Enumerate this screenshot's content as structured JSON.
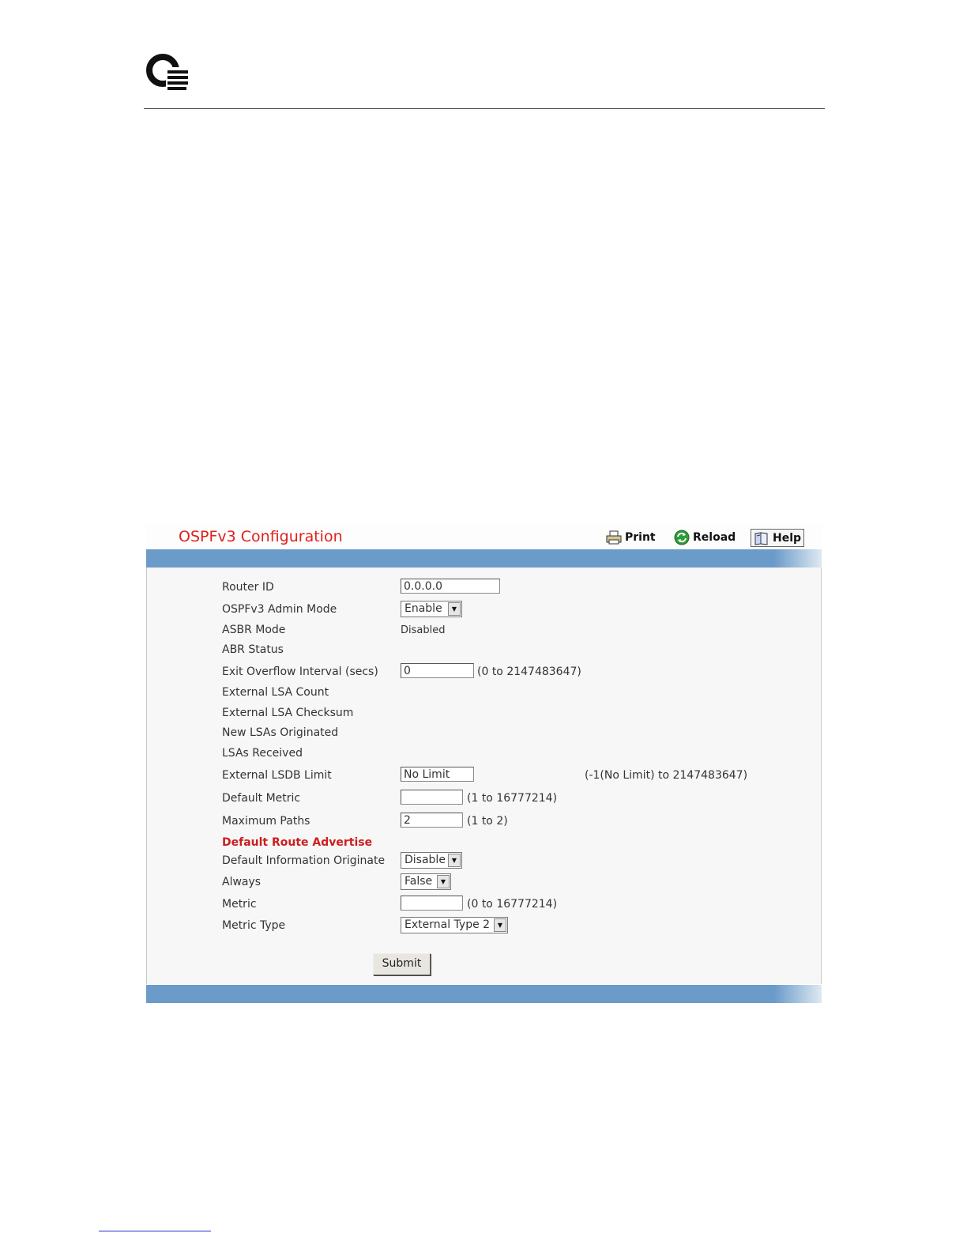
{
  "page": {
    "title": "OSPFv3 Configuration",
    "toolbar": {
      "print": "Print",
      "reload": "Reload",
      "help": "Help"
    }
  },
  "form": {
    "router_id": {
      "label": "Router ID",
      "value": "0.0.0.0"
    },
    "admin_mode": {
      "label": "OSPFv3 Admin Mode",
      "value": "Enable"
    },
    "asbr_mode": {
      "label": "ASBR Mode",
      "value": "Disabled"
    },
    "abr_status": {
      "label": "ABR Status",
      "value": ""
    },
    "exit_overflow": {
      "label": "Exit Overflow Interval (secs)",
      "value": "0",
      "hint": "(0 to 2147483647)"
    },
    "ext_lsa_count": {
      "label": "External LSA Count"
    },
    "ext_lsa_checksum": {
      "label": "External LSA Checksum"
    },
    "new_lsas": {
      "label": "New LSAs Originated"
    },
    "lsas_received": {
      "label": "LSAs Received"
    },
    "ext_lsdb_limit": {
      "label": "External LSDB Limit",
      "value": "No Limit",
      "hint": "(-1(No Limit) to 2147483647)"
    },
    "default_metric": {
      "label": "Default Metric",
      "value": "",
      "hint": "(1 to 16777214)"
    },
    "max_paths": {
      "label": "Maximum Paths",
      "value": "2",
      "hint": "(1 to 2)"
    },
    "section_heading": "Default Route Advertise",
    "default_info_originate": {
      "label": "Default Information Originate",
      "value": "Disable"
    },
    "always": {
      "label": "Always",
      "value": "False"
    },
    "metric": {
      "label": "Metric",
      "value": "",
      "hint": "(0 to 16777214)"
    },
    "metric_type": {
      "label": "Metric Type",
      "value": "External Type 2"
    },
    "submit": "Submit"
  },
  "colors": {
    "title": "#e0201c",
    "bar": "#6b9bc9",
    "heading": "#cc1e1e"
  },
  "icons": [
    "logo-icon",
    "printer-icon",
    "reload-icon",
    "help-book-icon",
    "chevron-down-icon"
  ]
}
